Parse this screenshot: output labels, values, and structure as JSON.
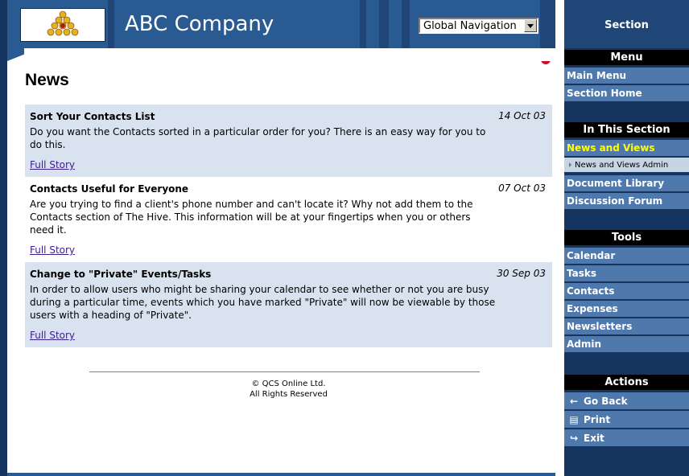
{
  "header": {
    "company": "ABC Company",
    "nav_select_value": "Global Navigation"
  },
  "main": {
    "page_title": "News",
    "articles": [
      {
        "title": "Sort Your Contacts List",
        "date": "14 Oct 03",
        "body": "Do you want the Contacts sorted in a particular order for you? There is an easy way for you to do this.",
        "link": "Full Story"
      },
      {
        "title": "Contacts Useful for Everyone",
        "date": "07 Oct 03",
        "body": "Are you trying to find a client's phone number and can't locate it? Why not add them to the Contacts section of The Hive. This information will be at your fingertips when you or others need it.",
        "link": "Full Story"
      },
      {
        "title": "Change to \"Private\" Events/Tasks",
        "date": "30 Sep 03",
        "body": "In order to allow users who might be sharing your calendar to see whether or not you are busy during a particular time, events which you have marked \"Private\" will now be viewable by those users with a heading of \"Private\".",
        "link": "Full Story"
      }
    ],
    "footer_line1": "© QCS Online Ltd.",
    "footer_line2": "All Rights Reserved"
  },
  "sidebar": {
    "title": "Section",
    "menu_heading": "Menu",
    "menu_items": [
      "Main Menu",
      "Section Home"
    ],
    "section_heading": "In This Section",
    "section_items": [
      "News and Views",
      "News and Views Admin",
      "Document Library",
      "Discussion Forum"
    ],
    "tools_heading": "Tools",
    "tools_items": [
      "Calendar",
      "Tasks",
      "Contacts",
      "Expenses",
      "Newsletters",
      "Admin"
    ],
    "actions_heading": "Actions",
    "actions": [
      "Go Back",
      "Print",
      "Exit"
    ]
  },
  "icons": {
    "back": "arrow-left-icon",
    "print": "printer-icon",
    "exit": "exit-door-icon",
    "help": "help-icon"
  },
  "colors": {
    "header_blue": "#2a5a92",
    "sidebar_dark": "#15345f",
    "sidebar_item": "#4f79ad",
    "active_item": "#ffff00",
    "article_shade": "#d9e3ef"
  }
}
